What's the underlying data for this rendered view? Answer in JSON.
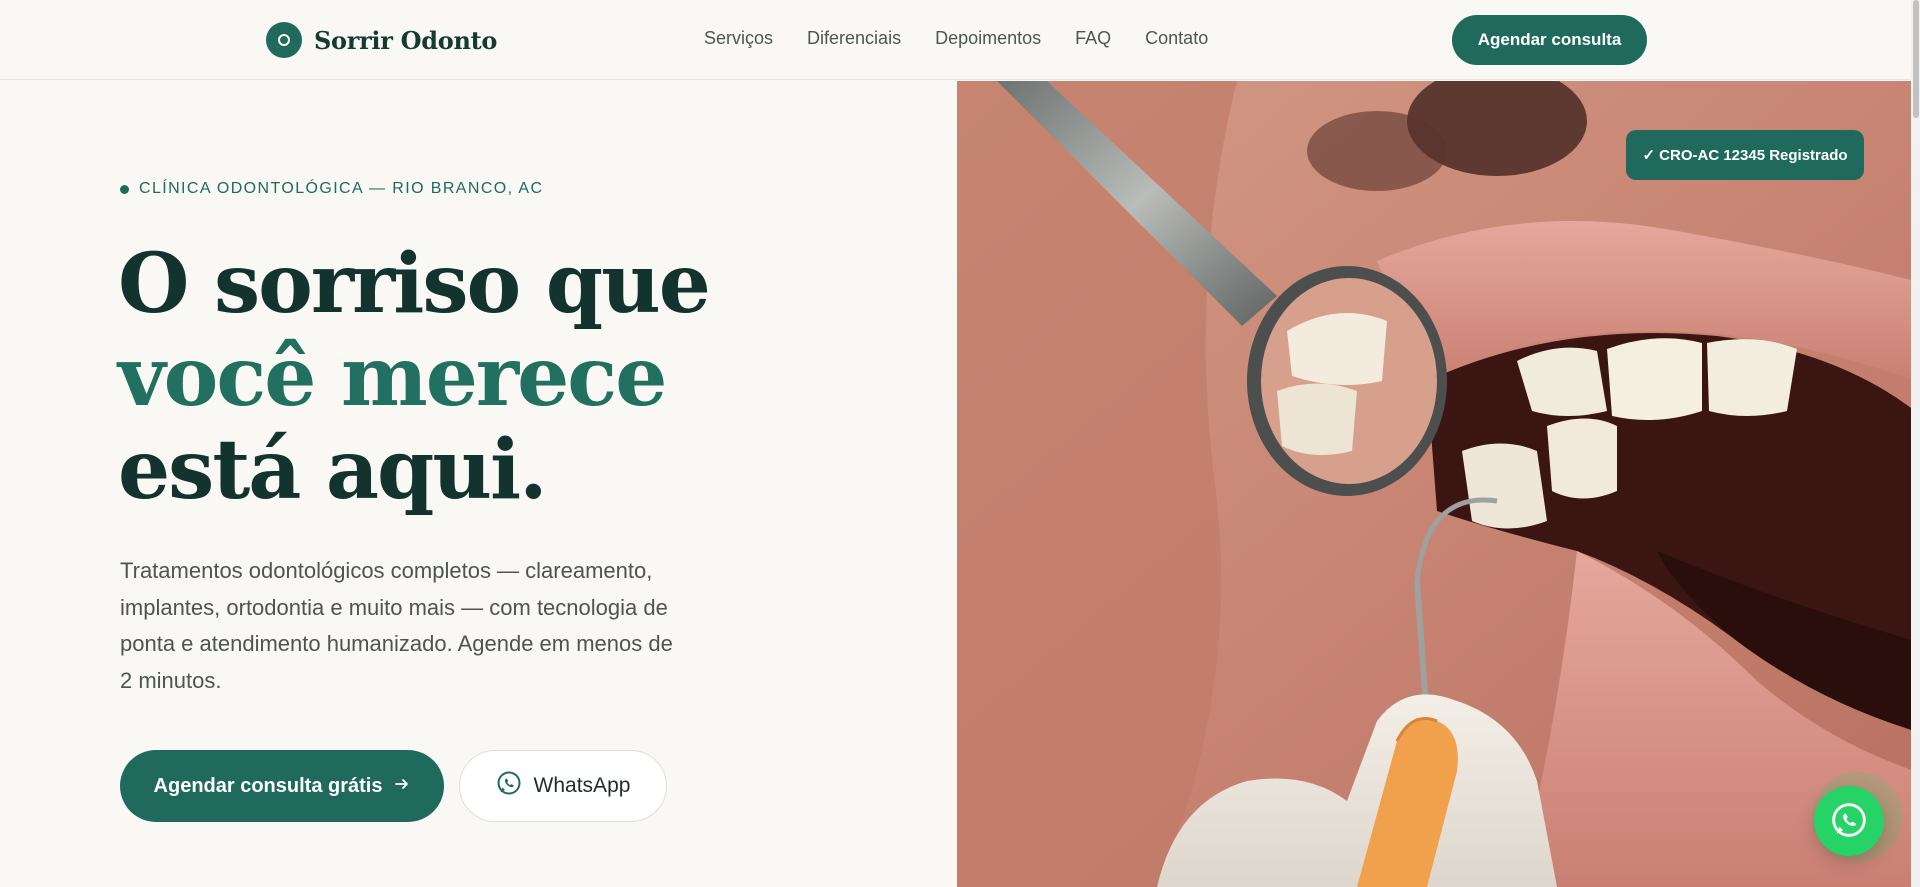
{
  "brand": {
    "name": "Sorrir Odonto"
  },
  "nav": {
    "items": [
      "Serviços",
      "Diferenciais",
      "Depoimentos",
      "FAQ",
      "Contato"
    ]
  },
  "header": {
    "cta_label": "Agendar consulta"
  },
  "hero": {
    "eyebrow": "CLÍNICA ODONTOLÓGICA — RIO BRANCO, AC",
    "headline_line1": "O sorriso que",
    "headline_line2": "você merece",
    "headline_line3": "está aqui.",
    "lead": "Tratamentos odontológicos completos — clareamento, implantes, ortodontia e muito mais — com tecnologia de ponta e atendimento humanizado. Agende em menos de 2 minutos.",
    "primary_cta": "Agendar consulta grátis",
    "secondary_cta": "WhatsApp"
  },
  "badge": {
    "label": "✓ CRO-AC 12345 Registrado"
  },
  "icons": {
    "brand": "tooth-logo-icon",
    "arrow": "arrow-right-icon",
    "whatsapp": "whatsapp-icon",
    "floating": "whatsapp-icon"
  },
  "colors": {
    "primary": "#1f6a5c",
    "dark_text": "#13342e",
    "accent_text": "#217060",
    "background": "#faf8f4",
    "whatsapp": "#25d366"
  }
}
